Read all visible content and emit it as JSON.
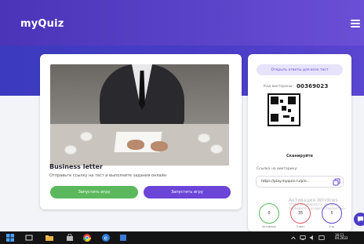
{
  "app": {
    "logo": "myQuiz"
  },
  "quiz": {
    "title": "Business letter",
    "subtitle": "Отправьте ссылку на тест и выполните задания онлайн",
    "start_button": "Запустить игру",
    "homework_button": "Запустить игру"
  },
  "sidebar": {
    "open_all_button": "Открыть ответы для всех тест",
    "code_label": "Код викторины:",
    "code_value": "00369023",
    "scan_label": "Сканируйте",
    "link_label": "Ссылка на викторину:",
    "link_value": "https://play.myquiz.ru/p/o...",
    "stats": [
      {
        "label": "Активных",
        "value": "0",
        "color": "#5cb85c"
      },
      {
        "label": "Ответ",
        "value": "35",
        "color": "#e05a66"
      },
      {
        "label": "Спр.",
        "value": "5",
        "color": "#6a45d8"
      }
    ]
  },
  "overlay": {
    "watermark_line1": "Активация Windows",
    "watermark_line2": "Чтобы активировать Windows, перейдите в раздел «Параметры»."
  },
  "taskbar": {
    "time": "16:11",
    "date": "04.2022"
  }
}
